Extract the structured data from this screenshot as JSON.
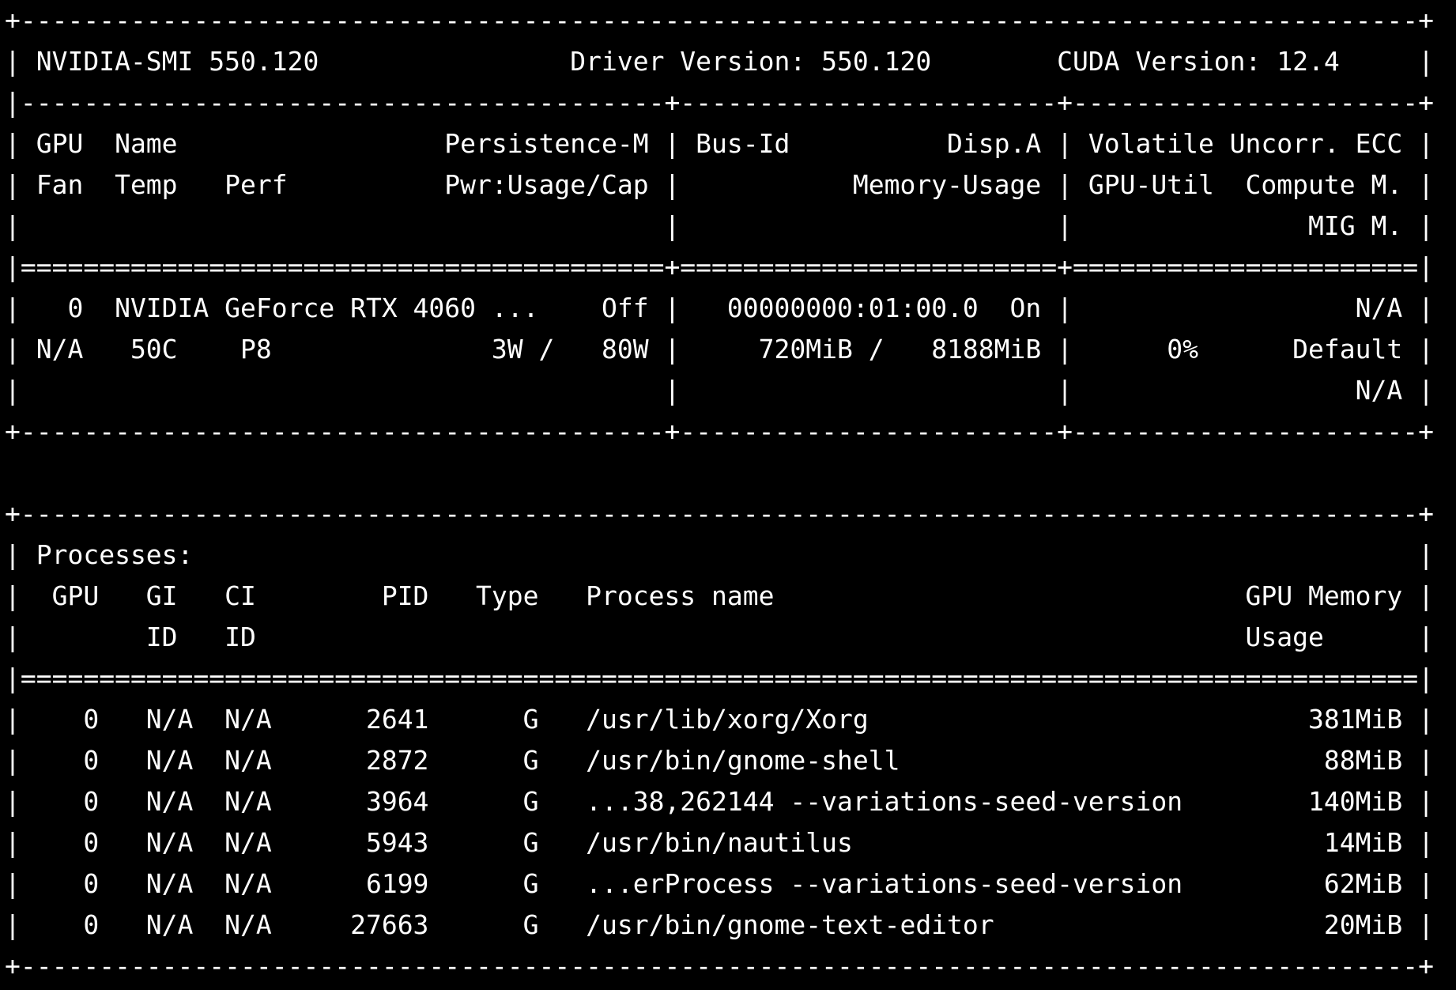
{
  "window": {
    "foreground": "#ffffff",
    "background": "#000000"
  },
  "lines": [
    "+-----------------------------------------------------------------------------------------+",
    "| NVIDIA-SMI 550.120                Driver Version: 550.120        CUDA Version: 12.4     |",
    "|-----------------------------------------+------------------------+----------------------+",
    "| GPU  Name                 Persistence-M | Bus-Id          Disp.A | Volatile Uncorr. ECC |",
    "| Fan  Temp   Perf          Pwr:Usage/Cap |           Memory-Usage | GPU-Util  Compute M. |",
    "|                                         |                        |               MIG M. |",
    "|=========================================+========================+======================|",
    "|   0  NVIDIA GeForce RTX 4060 ...    Off |   00000000:01:00.0  On |                  N/A |",
    "| N/A   50C    P8              3W /   80W |     720MiB /   8188MiB |      0%      Default |",
    "|                                         |                        |                  N/A |",
    "+-----------------------------------------+------------------------+----------------------+",
    "",
    "+-----------------------------------------------------------------------------------------+",
    "| Processes:                                                                              |",
    "|  GPU   GI   CI        PID   Type   Process name                              GPU Memory |",
    "|        ID   ID                                                               Usage      |",
    "|=========================================================================================|",
    "|    0   N/A  N/A      2641      G   /usr/lib/xorg/Xorg                            381MiB |",
    "|    0   N/A  N/A      2872      G   /usr/bin/gnome-shell                           88MiB |",
    "|    0   N/A  N/A      3964      G   ...38,262144 --variations-seed-version        140MiB |",
    "|    0   N/A  N/A      5943      G   /usr/bin/nautilus                              14MiB |",
    "|    0   N/A  N/A      6199      G   ...erProcess --variations-seed-version         62MiB |",
    "|    0   N/A  N/A     27663      G   /usr/bin/gnome-text-editor                     20MiB |",
    "+-----------------------------------------------------------------------------------------+"
  ]
}
